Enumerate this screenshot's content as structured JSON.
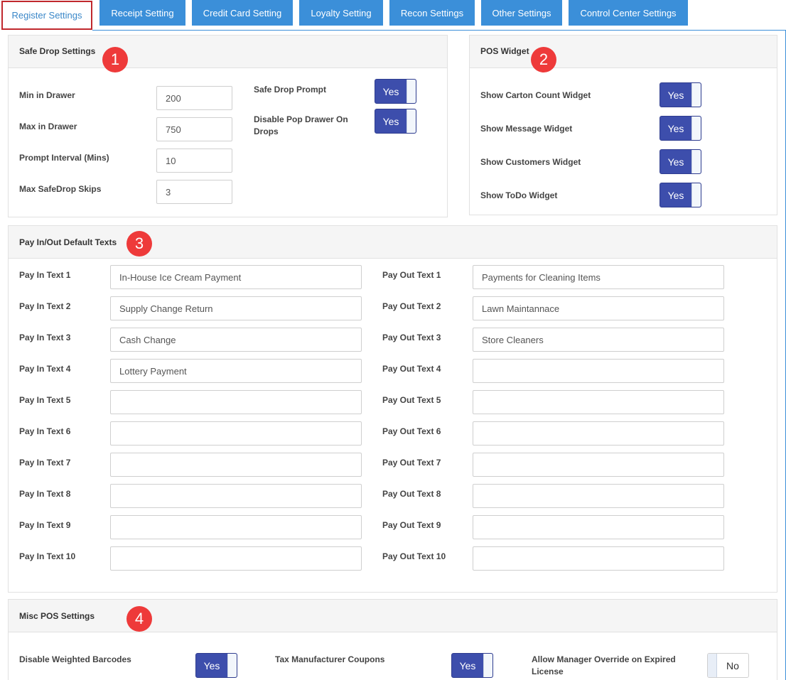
{
  "tabs": [
    {
      "label": "Register Settings",
      "active": true
    },
    {
      "label": "Receipt Setting"
    },
    {
      "label": "Credit Card Setting"
    },
    {
      "label": "Loyalty Setting"
    },
    {
      "label": "Recon Settings"
    },
    {
      "label": "Other Settings"
    },
    {
      "label": "Control Center Settings"
    }
  ],
  "colors": {
    "accent": "#3b8fd9",
    "active_border": "#c0282d",
    "toggle_on": "#3d4eac",
    "badge": "#ee3a3a"
  },
  "badges": [
    "1",
    "2",
    "3",
    "4"
  ],
  "safe_drop": {
    "title": "Safe Drop Settings",
    "fields": [
      {
        "label": "Min in Drawer",
        "value": "200"
      },
      {
        "label": "Max in Drawer",
        "value": "750"
      },
      {
        "label": "Prompt Interval (Mins)",
        "value": "10"
      },
      {
        "label": "Max SafeDrop Skips",
        "value": "3"
      }
    ],
    "toggles": [
      {
        "label": "Safe Drop Prompt",
        "value": "Yes"
      },
      {
        "label": "Disable Pop Drawer On Drops",
        "value": "Yes"
      }
    ]
  },
  "pos_widget": {
    "title": "POS Widget",
    "toggles": [
      {
        "label": "Show Carton Count Widget",
        "value": "Yes"
      },
      {
        "label": "Show Message Widget",
        "value": "Yes"
      },
      {
        "label": "Show Customers Widget",
        "value": "Yes"
      },
      {
        "label": "Show ToDo Widget",
        "value": "Yes"
      }
    ]
  },
  "pay_texts": {
    "title": "Pay In/Out Default Texts",
    "pay_in": [
      {
        "label": "Pay In Text 1",
        "value": "In-House Ice Cream Payment"
      },
      {
        "label": "Pay In Text 2",
        "value": "Supply Change Return"
      },
      {
        "label": "Pay In Text 3",
        "value": "Cash Change"
      },
      {
        "label": "Pay In Text 4",
        "value": "Lottery Payment"
      },
      {
        "label": "Pay In Text 5",
        "value": ""
      },
      {
        "label": "Pay In Text 6",
        "value": ""
      },
      {
        "label": "Pay In Text 7",
        "value": ""
      },
      {
        "label": "Pay In Text 8",
        "value": ""
      },
      {
        "label": "Pay In Text 9",
        "value": ""
      },
      {
        "label": "Pay In Text 10",
        "value": ""
      }
    ],
    "pay_out": [
      {
        "label": "Pay Out Text 1",
        "value": "Payments for Cleaning Items"
      },
      {
        "label": "Pay Out Text 2",
        "value": "Lawn Maintannace"
      },
      {
        "label": "Pay Out Text 3",
        "value": "Store Cleaners"
      },
      {
        "label": "Pay Out Text 4",
        "value": ""
      },
      {
        "label": "Pay Out Text 5",
        "value": ""
      },
      {
        "label": "Pay Out Text 6",
        "value": ""
      },
      {
        "label": "Pay Out Text 7",
        "value": ""
      },
      {
        "label": "Pay Out Text 8",
        "value": ""
      },
      {
        "label": "Pay Out Text 9",
        "value": ""
      },
      {
        "label": "Pay Out Text 10",
        "value": ""
      }
    ]
  },
  "misc": {
    "title": "Misc POS Settings",
    "toggles": [
      {
        "label": "Disable Weighted Barcodes",
        "value": "Yes"
      },
      {
        "label": "Tax Manufacturer Coupons",
        "value": "Yes"
      },
      {
        "label": "Allow Manager Override on Expired License",
        "value": "No"
      }
    ]
  }
}
